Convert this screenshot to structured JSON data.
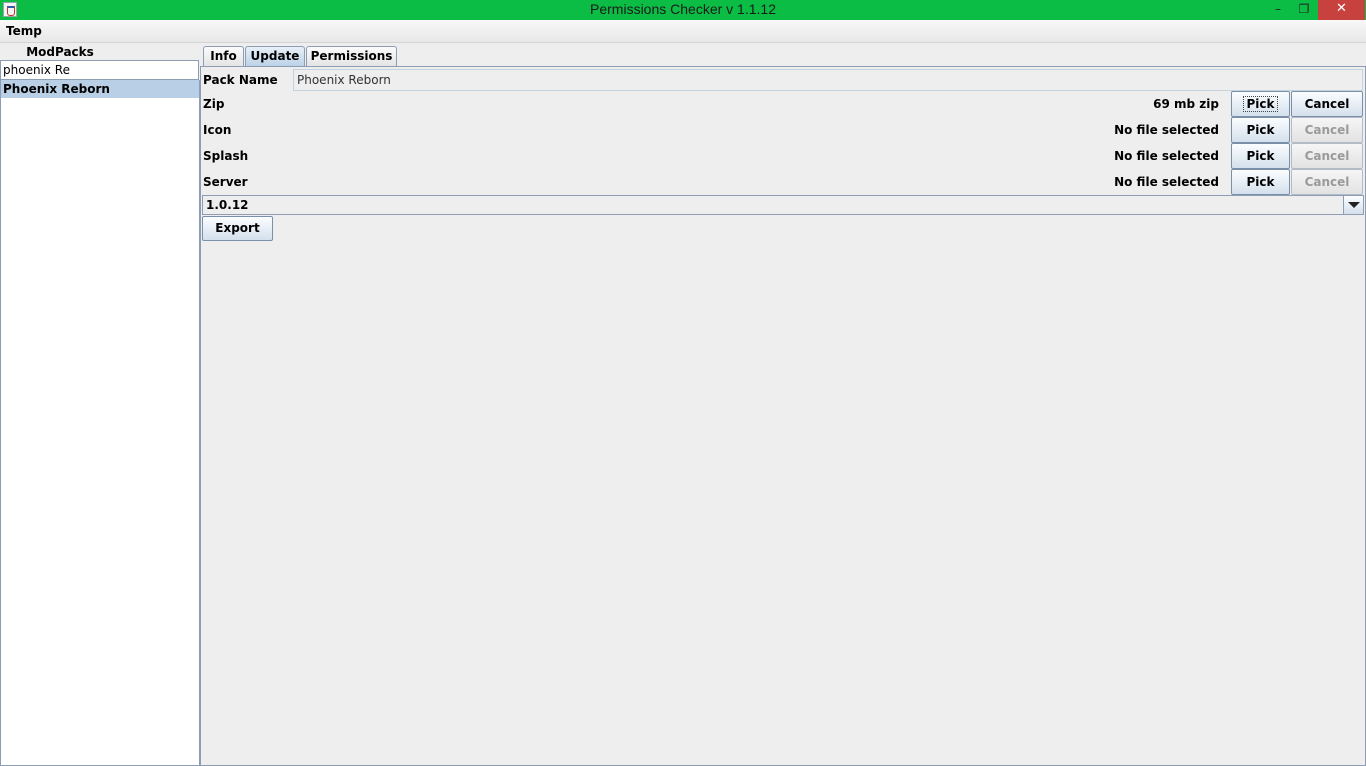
{
  "window": {
    "title": "Permissions Checker v 1.1.12",
    "minimize_glyph": "–",
    "maximize_glyph": "❐",
    "close_glyph": "✕",
    "titlebar_color": "#0bbd45",
    "close_color": "#c7413e"
  },
  "menu": {
    "items": [
      {
        "label": "Temp"
      }
    ]
  },
  "sidebar": {
    "header": "ModPacks",
    "search": {
      "value": "phoenix Re",
      "placeholder": ""
    },
    "items": [
      {
        "label": "Phoenix Reborn",
        "selected": true
      }
    ],
    "selection_color": "#b8cfe5"
  },
  "tabs": [
    {
      "label": "Info",
      "active": false
    },
    {
      "label": "Update",
      "active": true
    },
    {
      "label": "Permissions",
      "active": false
    }
  ],
  "update": {
    "pack_name_label": "Pack Name",
    "pack_name_value": "Phoenix Reborn",
    "rows": [
      {
        "label": "Zip",
        "status": "69 mb zip",
        "pick": "Pick",
        "cancel": "Cancel",
        "cancel_enabled": true
      },
      {
        "label": "Icon",
        "status": "No file selected",
        "pick": "Pick",
        "cancel": "Cancel",
        "cancel_enabled": false
      },
      {
        "label": "Splash",
        "status": "No file selected",
        "pick": "Pick",
        "cancel": "Cancel",
        "cancel_enabled": false
      },
      {
        "label": "Server",
        "status": "No file selected",
        "pick": "Pick",
        "cancel": "Cancel",
        "cancel_enabled": false
      }
    ],
    "version": {
      "selected": "1.0.12"
    },
    "export_label": "Export"
  }
}
